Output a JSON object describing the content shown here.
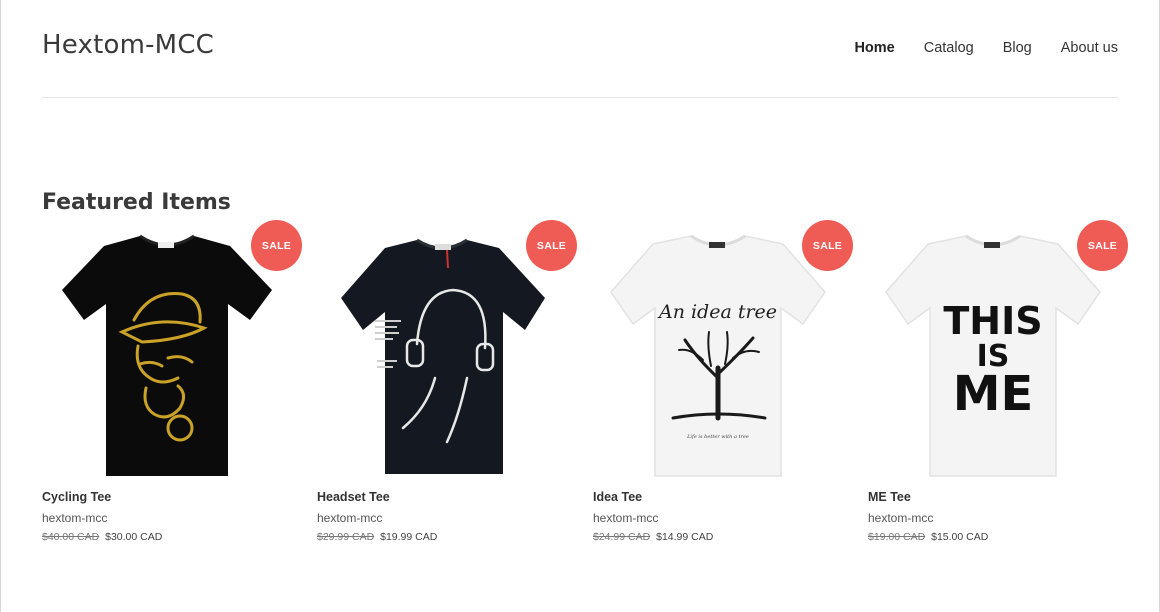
{
  "site": {
    "logo": "Hextom-MCC",
    "nav": [
      {
        "label": "Home",
        "active": true
      },
      {
        "label": "Catalog",
        "active": false
      },
      {
        "label": "Blog",
        "active": false
      },
      {
        "label": "About us",
        "active": false
      }
    ]
  },
  "featured": {
    "title": "Featured Items",
    "products": [
      {
        "title": "Cycling Tee",
        "vendor": "hextom-mcc",
        "compare_price": "$40.00 CAD",
        "price": "$30.00 CAD",
        "badge": "SALE",
        "shirt_color": "#0b0b0b",
        "graphic": "gold-cap-face-graphic"
      },
      {
        "title": "Headset Tee",
        "vendor": "hextom-mcc",
        "compare_price": "$29.99 CAD",
        "price": "$19.99 CAD",
        "badge": "SALE",
        "shirt_color": "#141820",
        "graphic": "headphones-graphic"
      },
      {
        "title": "Idea Tee",
        "vendor": "hextom-mcc",
        "compare_price": "$24.99 CAD",
        "price": "$14.99 CAD",
        "badge": "SALE",
        "shirt_color": "#f4f4f4",
        "graphic": "An idea tree",
        "graphic_subtext": "Life is better with a tree"
      },
      {
        "title": "ME Tee",
        "vendor": "hextom-mcc",
        "compare_price": "$19.00 CAD",
        "price": "$15.00 CAD",
        "badge": "SALE",
        "shirt_color": "#f4f4f4",
        "graphic_lines": [
          "THIS",
          "IS",
          "ME"
        ]
      }
    ]
  },
  "colors": {
    "sale_badge": "#ef5b55",
    "divider": "#e6e6e6"
  }
}
